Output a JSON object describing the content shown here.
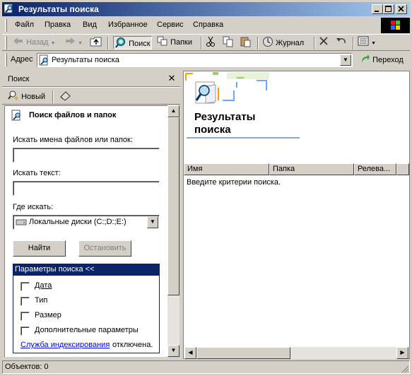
{
  "window": {
    "title": "Результаты поиска"
  },
  "menu": [
    "Файл",
    "Правка",
    "Вид",
    "Избранное",
    "Сервис",
    "Справка"
  ],
  "toolbar": {
    "back": "Назад",
    "search": "Поиск",
    "folders": "Папки",
    "history": "Журнал"
  },
  "address": {
    "label": "Адрес",
    "value": "Результаты поиска",
    "go": "Переход"
  },
  "search_pane": {
    "title": "Поиск",
    "new_button": "Новый",
    "heading": "Поиск файлов и папок",
    "names_label": "Искать имена файлов или папок:",
    "names_value": "",
    "text_label": "Искать текст:",
    "text_value": "",
    "where_label": "Где искать:",
    "where_value": "Локальные диски (C:;D:;E:)",
    "find_button": "Найти",
    "stop_button": "Остановить",
    "options_header": "Параметры поиска <<",
    "options": [
      "Дата",
      "Тип",
      "Размер",
      "Дополнительные параметры"
    ],
    "index_link": "Служба индексирования",
    "index_status": "отключена."
  },
  "results": {
    "title_line1": "Результаты",
    "title_line2": "поиска",
    "columns": [
      "Имя",
      "Папка",
      "Релева..."
    ],
    "message": "Введите критерии поиска."
  },
  "status": {
    "text": "Объектов: 0"
  },
  "colors": {
    "title_start": "#0a246a",
    "title_end": "#a6caf0",
    "options_header": "#0a246a"
  }
}
